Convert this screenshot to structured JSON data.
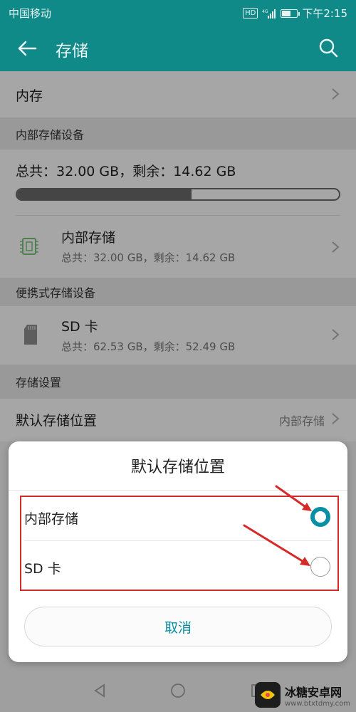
{
  "status_bar": {
    "carrier": "中国移动",
    "hd_badge": "HD",
    "network": "4G",
    "time": "下午2:15"
  },
  "app_bar": {
    "title": "存储",
    "back_icon": "arrow-left-icon",
    "search_icon": "search-icon"
  },
  "memory_row": {
    "label": "内存"
  },
  "internal_section": {
    "header": "内部存储设备",
    "summary": "总共：32.00 GB，剩余：14.62 GB",
    "usage_fraction": 0.543,
    "device": {
      "name": "内部存储",
      "detail": "总共：32.00 GB，剩余：14.62 GB",
      "icon": "chip-icon"
    }
  },
  "portable_section": {
    "header": "便携式存储设备",
    "device": {
      "name": "SD 卡",
      "detail": "总共：62.53 GB，剩余：52.49 GB",
      "icon": "sd-card-icon"
    }
  },
  "settings_section": {
    "header": "存储设置",
    "default_location": {
      "label": "默认存储位置",
      "value": "内部存储"
    }
  },
  "dialog": {
    "title": "默认存储位置",
    "options": [
      {
        "label": "内部存储",
        "selected": true
      },
      {
        "label": "SD 卡",
        "selected": false
      }
    ],
    "cancel_label": "取消"
  },
  "colors": {
    "accent": "#0f8a88",
    "radio_selected": "#0b8fa5",
    "annotation": "#d62a2a"
  },
  "watermark": {
    "text": "冰糖安卓网",
    "url_text": "www.btxtdmy.com"
  }
}
